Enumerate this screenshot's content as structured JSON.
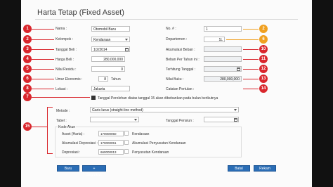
{
  "header": {
    "title": "Harta Tetap (Fixed Asset)"
  },
  "left_form": {
    "nama_label": "Nama :",
    "nama_value": "Otomobil Baru",
    "kelompok_label": "Kelompok :",
    "kelompok_value": "Kendaraan",
    "tanggal_beli_label": "Tanggal Beli :",
    "tanggal_beli_value": "1/2/2014",
    "harga_beli_label": "Harga Beli :",
    "harga_beli_value": "280,000,000",
    "nilai_residu_label": "Nilai Residu :",
    "nilai_residu_value": "0",
    "umur_label": "Umur Ekonomis :",
    "umur_value": "8",
    "umur_unit": "Tahun",
    "lokasi_label": "Lokasi :",
    "lokasi_value": "Jakarta"
  },
  "right_form": {
    "no_label": "No. # :",
    "no_value": "1",
    "departemen_label": "Departemen :",
    "departemen_value": "1L",
    "akumulasi_label": "Akumulasi Beban :",
    "beban_per_tahun_label": "Beban Per Tahun ini :",
    "terhitung_label": "Terhitung Tanggal :",
    "nilai_buku_label": "Nilai Buku :",
    "nilai_buku_value": "280,000,000",
    "catatan_label": "Catatan Pertulan :"
  },
  "badges": {
    "red": [
      "1",
      "2",
      "3",
      "4",
      "5",
      "6",
      "7",
      "8"
    ],
    "orange": [
      "2",
      "6"
    ],
    "right_red": [
      "10",
      "11",
      "12",
      "13",
      "14"
    ],
    "fifteen": "15"
  },
  "checkbox_text": "Tanggal Perolehan diatas tanggal 15 akan dibebankan pada bulan berikutnya",
  "depreciation": {
    "metode_label": "Metode :",
    "metode_value": "Garis lurus (straight-line method)",
    "tabel_label": "Tabel :",
    "tanggal_pensiun_label": "Tanggal Pensiun :",
    "kode_akun_label": "Kode Akun",
    "rows": [
      {
        "label": "Asset (Harta) :",
        "code": "170000050",
        "name": "Kendaraan"
      },
      {
        "label": "Akumulasi Depresiasi :",
        "code": "170000051",
        "name": "Akumulasi Penyusutan Kendaraan"
      },
      {
        "label": "Depresiasi :",
        "code": "660000013",
        "name": "Penyusutan Kendaraan"
      }
    ]
  },
  "footer": {
    "baru_label": "Baru",
    "segarkan_label": "Segarkan",
    "batal_label": "Batal",
    "rekam_label": "Rekam"
  },
  "colors": {
    "red_badge": "#d9262c",
    "orange_badge": "#f0a020",
    "button_blue": "#2a6db5"
  }
}
